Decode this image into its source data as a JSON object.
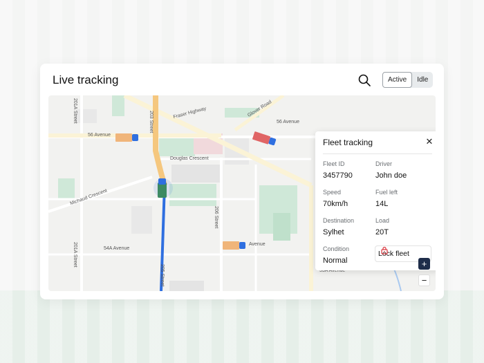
{
  "header": {
    "title": "Live tracking",
    "search_icon": "search-icon",
    "status_toggle": {
      "options": [
        "Active",
        "Idle"
      ],
      "selected": "Active"
    }
  },
  "map": {
    "streets": [
      "56 Avenue",
      "203 Street",
      "Fraser Highway",
      "Glover Road",
      "56 Avenue",
      "Douglas Crescent",
      "Michaud Crescent",
      "201A Street",
      "206 Street",
      "54A Avenue",
      "201A Street",
      "205 Street",
      "Avenue",
      "53A Avenue"
    ],
    "colors": {
      "route": "#2f6fe0",
      "park": "#cfe8d8",
      "road": "#fbf3d6",
      "building": "#e2e2e2"
    },
    "zoom_in_label": "+",
    "zoom_out_label": "−"
  },
  "fleet_panel": {
    "title": "Fleet tracking",
    "close_icon": "close-icon",
    "fields": [
      {
        "label": "Fleet ID",
        "value": "3457790"
      },
      {
        "label": "Driver",
        "value": "John doe"
      },
      {
        "label": "Speed",
        "value": "70km/h"
      },
      {
        "label": "Fuel left",
        "value": "14L"
      },
      {
        "label": "Destination",
        "value": "Sylhet"
      },
      {
        "label": "Load",
        "value": "20T"
      },
      {
        "label": "Condition",
        "value": "Normal"
      }
    ],
    "lock_button": {
      "label": "Lock fleet",
      "icon": "lock-icon",
      "color": "#d9363e"
    }
  }
}
